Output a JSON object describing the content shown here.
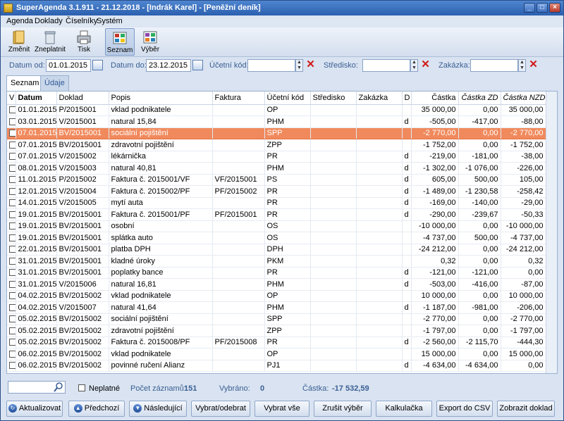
{
  "window": {
    "title": "SuperAgenda 3.1.911 - 21.12.2018 - [Indrák Karel] - [Peněžní deník]"
  },
  "menu": [
    "Agenda",
    "Doklady",
    "Číselníky",
    "Systém"
  ],
  "toolbar": {
    "zmenit": "Změnit",
    "zneplatnit": "Zneplatnit",
    "tisk": "Tisk",
    "seznam": "Seznam",
    "vyber": "Výběr"
  },
  "filters": {
    "datum_od_label": "Datum od:",
    "datum_od": "01.01.2015",
    "datum_do_label": "Datum do:",
    "datum_do": "23.12.2015",
    "ucetni_kod_label": "Účetní kód:",
    "stredisko_label": "Středisko:",
    "zakazka_label": "Zakázka:"
  },
  "tabs": [
    "Seznam",
    "Údaje"
  ],
  "columns": [
    "V",
    "Datum",
    "Doklad",
    "Popis",
    "Faktura",
    "Účetní kód",
    "Středisko",
    "Zakázka",
    "D",
    "Částka",
    "Částka ZD",
    "Částka NZD"
  ],
  "rows": [
    [
      "01.01.2015",
      "P/2015001",
      "vklad podnikatele",
      "",
      "OP",
      "",
      "",
      "",
      "35 000,00",
      "0,00",
      "35 000,00"
    ],
    [
      "03.01.2015",
      "V/2015001",
      "natural 15,84",
      "",
      "PHM",
      "",
      "",
      "d",
      "-505,00",
      "-417,00",
      "-88,00"
    ],
    [
      "07.01.2015",
      "BV/2015001",
      "sociální pojištění",
      "",
      "SPP",
      "",
      "",
      "",
      "-2 770,00",
      "0,00",
      "-2 770,00"
    ],
    [
      "07.01.2015",
      "BV/2015001",
      "zdravotní pojištění",
      "",
      "ZPP",
      "",
      "",
      "",
      "-1 752,00",
      "0,00",
      "-1 752,00"
    ],
    [
      "07.01.2015",
      "V/2015002",
      "lékárnička",
      "",
      "PR",
      "",
      "",
      "d",
      "-219,00",
      "-181,00",
      "-38,00"
    ],
    [
      "08.01.2015",
      "V/2015003",
      "natural 40,81",
      "",
      "PHM",
      "",
      "",
      "d",
      "-1 302,00",
      "-1 076,00",
      "-226,00"
    ],
    [
      "11.01.2015",
      "P/2015002",
      "Faktura č. 2015001/VF",
      "VF/2015001",
      "PS",
      "",
      "",
      "d",
      "605,00",
      "500,00",
      "105,00"
    ],
    [
      "12.01.2015",
      "V/2015004",
      "Faktura č. 2015002/PF",
      "PF/2015002",
      "PR",
      "",
      "",
      "d",
      "-1 489,00",
      "-1 230,58",
      "-258,42"
    ],
    [
      "14.01.2015",
      "V/2015005",
      "mytí auta",
      "",
      "PR",
      "",
      "",
      "d",
      "-169,00",
      "-140,00",
      "-29,00"
    ],
    [
      "19.01.2015",
      "BV/2015001",
      "Faktura č. 2015001/PF",
      "PF/2015001",
      "PR",
      "",
      "",
      "d",
      "-290,00",
      "-239,67",
      "-50,33"
    ],
    [
      "19.01.2015",
      "BV/2015001",
      "osobní",
      "",
      "OS",
      "",
      "",
      "",
      "-10 000,00",
      "0,00",
      "-10 000,00"
    ],
    [
      "19.01.2015",
      "BV/2015001",
      "splátka auto",
      "",
      "OS",
      "",
      "",
      "",
      "-4 737,00",
      "500,00",
      "-4 737,00"
    ],
    [
      "22.01.2015",
      "BV/2015001",
      "platba DPH",
      "",
      "DPH",
      "",
      "",
      "",
      "-24 212,00",
      "0,00",
      "-24 212,00"
    ],
    [
      "31.01.2015",
      "BV/2015001",
      "kladné úroky",
      "",
      "PKM",
      "",
      "",
      "",
      "0,32",
      "0,00",
      "0,32"
    ],
    [
      "31.01.2015",
      "BV/2015001",
      "poplatky bance",
      "",
      "PR",
      "",
      "",
      "d",
      "-121,00",
      "-121,00",
      "0,00"
    ],
    [
      "31.01.2015",
      "V/2015006",
      "natural 16,81",
      "",
      "PHM",
      "",
      "",
      "d",
      "-503,00",
      "-416,00",
      "-87,00"
    ],
    [
      "04.02.2015",
      "BV/2015002",
      "vklad podnikatele",
      "",
      "OP",
      "",
      "",
      "",
      "10 000,00",
      "0,00",
      "10 000,00"
    ],
    [
      "04.02.2015",
      "V/2015007",
      "natural 41,64",
      "",
      "PHM",
      "",
      "",
      "d",
      "-1 187,00",
      "-981,00",
      "-206,00"
    ],
    [
      "05.02.2015",
      "BV/2015002",
      "sociální pojištění",
      "",
      "SPP",
      "",
      "",
      "",
      "-2 770,00",
      "0,00",
      "-2 770,00"
    ],
    [
      "05.02.2015",
      "BV/2015002",
      "zdravotní pojištění",
      "",
      "ZPP",
      "",
      "",
      "",
      "-1 797,00",
      "0,00",
      "-1 797,00"
    ],
    [
      "05.02.2015",
      "BV/2015002",
      "Faktura č. 2015008/PF",
      "PF/2015008",
      "PR",
      "",
      "",
      "d",
      "-2 560,00",
      "-2 115,70",
      "-444,30"
    ],
    [
      "06.02.2015",
      "BV/2015002",
      "vklad podnikatele",
      "",
      "OP",
      "",
      "",
      "",
      "15 000,00",
      "0,00",
      "15 000,00"
    ],
    [
      "06.02.2015",
      "BV/2015002",
      "povinné ručení Alianz",
      "",
      "PJ1",
      "",
      "",
      "d",
      "-4 634,00",
      "-4 634,00",
      "0,00"
    ]
  ],
  "selected_row": 2,
  "status": {
    "neplatne": "Neplatné",
    "pocet_label": "Počet záznamů:",
    "pocet": "151",
    "vybrano_label": "Vybráno:",
    "vybrano": "0",
    "castka_label": "Částka:",
    "castka": "-17 532,59"
  },
  "buttons": [
    "Aktualizovat",
    "Předchozí",
    "Následující",
    "Vybrat/odebrat",
    "Vybrat vše",
    "Zrušit výběr",
    "Kalkulačka",
    "Export do CSV",
    "Zobrazit doklad"
  ],
  "colors": {
    "selection": "#f08a5d",
    "titlebar": "#2b5fae",
    "label": "#3a5f94"
  }
}
